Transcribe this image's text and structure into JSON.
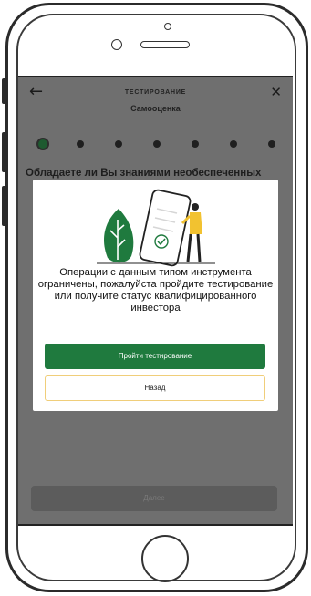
{
  "app": {
    "header": {
      "title": "ТЕСТИРОВАНИЕ",
      "subtitle": "Самооценка",
      "back_icon": "arrow-left-icon",
      "close_icon": "close-icon"
    },
    "stepper": {
      "total_steps": 7,
      "current_step": 1
    },
    "question": "Обладаете ли Вы знаниями необеспеченных",
    "next_button_label": "Далее"
  },
  "modal": {
    "illustration_icon": "phone-with-person-and-leaf-icon",
    "message": "Операции с данным типом инструмента ограничены, пожалуйста пройдите тестирование или получите статус квалифицированного инвестора",
    "primary_button_label": "Пройти тестирование",
    "secondary_button_label": "Назад"
  },
  "colors": {
    "overlay": "#6f6f6f",
    "primary_green": "#1f7a3e",
    "secondary_border": "#f0ce7a",
    "modal_bg": "#ffffff"
  }
}
